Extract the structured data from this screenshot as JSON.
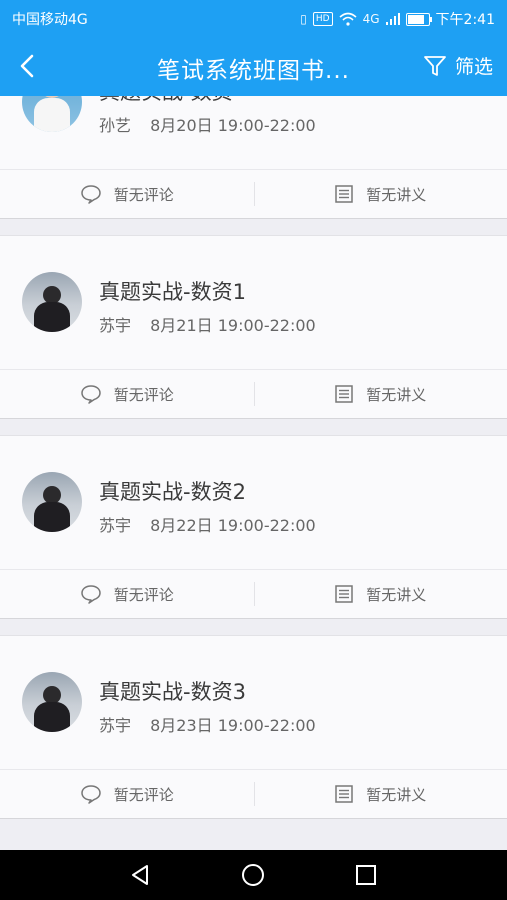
{
  "status_bar": {
    "carrier": "中国移动4G",
    "hd_badge": "HD",
    "signal_label": "4G",
    "time": "下午2:41"
  },
  "header": {
    "title": "笔试系统班图书...",
    "filter_label": "筛选"
  },
  "sessions": [
    {
      "title": "真题实战-数资",
      "teacher": "孙艺",
      "time": "8月20日 19:00-22:00",
      "comments_label": "暂无评论",
      "notes_label": "暂无讲义"
    },
    {
      "title": "真题实战-数资1",
      "teacher": "苏宇",
      "time": "8月21日 19:00-22:00",
      "comments_label": "暂无评论",
      "notes_label": "暂无讲义"
    },
    {
      "title": "真题实战-数资2",
      "teacher": "苏宇",
      "time": "8月22日 19:00-22:00",
      "comments_label": "暂无评论",
      "notes_label": "暂无讲义"
    },
    {
      "title": "真题实战-数资3",
      "teacher": "苏宇",
      "time": "8月23日 19:00-22:00",
      "comments_label": "暂无评论",
      "notes_label": "暂无讲义"
    }
  ],
  "colors": {
    "accent": "#1ea0f3",
    "background": "#eeeef3",
    "card": "#fafafc"
  },
  "icons": {
    "back": "chevron-left-icon",
    "filter": "filter-icon",
    "comment": "speech-bubble-icon",
    "notes": "document-list-icon",
    "nav_back": "triangle-back-icon",
    "nav_home": "circle-home-icon",
    "nav_recent": "square-recent-icon"
  }
}
